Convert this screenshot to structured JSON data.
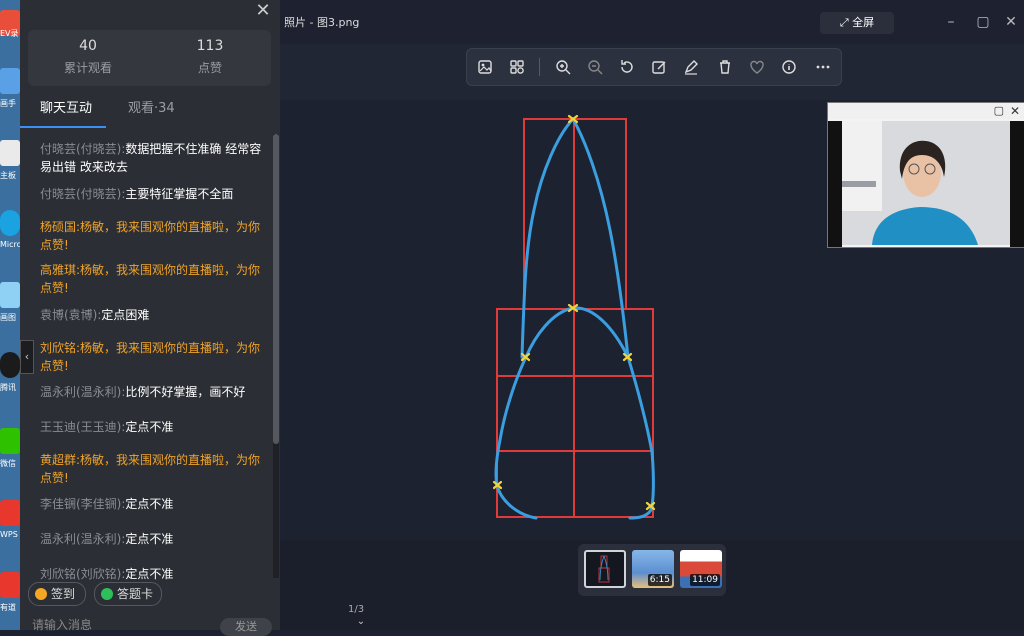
{
  "desktop": {
    "labels": [
      "EV录",
      "画手",
      "主板",
      "Micro Edg",
      "画图",
      "腾讯",
      "微信",
      "WPS O",
      "有道"
    ]
  },
  "panel": {
    "stats": [
      {
        "value": "40",
        "label": "累计观看"
      },
      {
        "value": "113",
        "label": "点赞"
      }
    ],
    "tabs": {
      "chat": "聊天互动",
      "viewers": "观看·34"
    },
    "messages": [
      {
        "name": "付晓芸(付晓芸):",
        "text": "数据把握不住准确 经常容易出错 改来改去",
        "type": "user"
      },
      {
        "name": "付晓芸(付晓芸):",
        "text": "主要特征掌握不全面",
        "type": "user"
      },
      {
        "name": "杨硕国:",
        "text": "杨敏，我来围观你的直播啦，为你点赞!",
        "type": "sys"
      },
      {
        "name": "高雅琪:",
        "text": "杨敏，我来围观你的直播啦，为你点赞!",
        "type": "sys"
      },
      {
        "name": "袁博(袁博):",
        "text": "定点困难",
        "type": "user"
      },
      {
        "name": "刘欣铭:",
        "text": "杨敏，我来围观你的直播啦，为你点赞!",
        "type": "sys"
      },
      {
        "name": "温永利(温永利):",
        "text": "比例不好掌握，画不好",
        "type": "user"
      },
      {
        "name": "王玉迪(王玉迪):",
        "text": "定点不准",
        "type": "user"
      },
      {
        "name": "黄超群:",
        "text": "杨敏，我来围观你的直播啦，为你点赞!",
        "type": "sys"
      },
      {
        "name": "李佳锎(李佳锎):",
        "text": "定点不准",
        "type": "user"
      },
      {
        "name": "温永利(温永利):",
        "text": "定点不准",
        "type": "user"
      },
      {
        "name": "刘欣铭(刘欣铭):",
        "text": "定点不准",
        "type": "user"
      }
    ],
    "sign_label": "签到",
    "card_label": "答题卡",
    "input_placeholder": "请输入消息",
    "send_label": "发送",
    "colors": {
      "accent": "#3b8ff5",
      "system_message": "#f0a328"
    }
  },
  "viewer": {
    "title": "照片 - 图3.png",
    "fullscreen_label": "全屏",
    "toolbar_icons": [
      "image-icon",
      "apps-icon",
      "zoom-in-icon",
      "zoom-out-icon",
      "rotate-icon",
      "edit-icon",
      "draw-icon",
      "delete-icon",
      "heart-icon",
      "info-icon",
      "more-icon"
    ],
    "thumbnails": [
      {
        "badge": ""
      },
      {
        "badge": "6:15"
      },
      {
        "badge": "11:09"
      }
    ],
    "page_indicator": "1/3"
  },
  "drawing": {
    "colors": {
      "grid": "#e03b3b",
      "outline": "#3a9ee0",
      "marks": "#f2d43a"
    }
  }
}
